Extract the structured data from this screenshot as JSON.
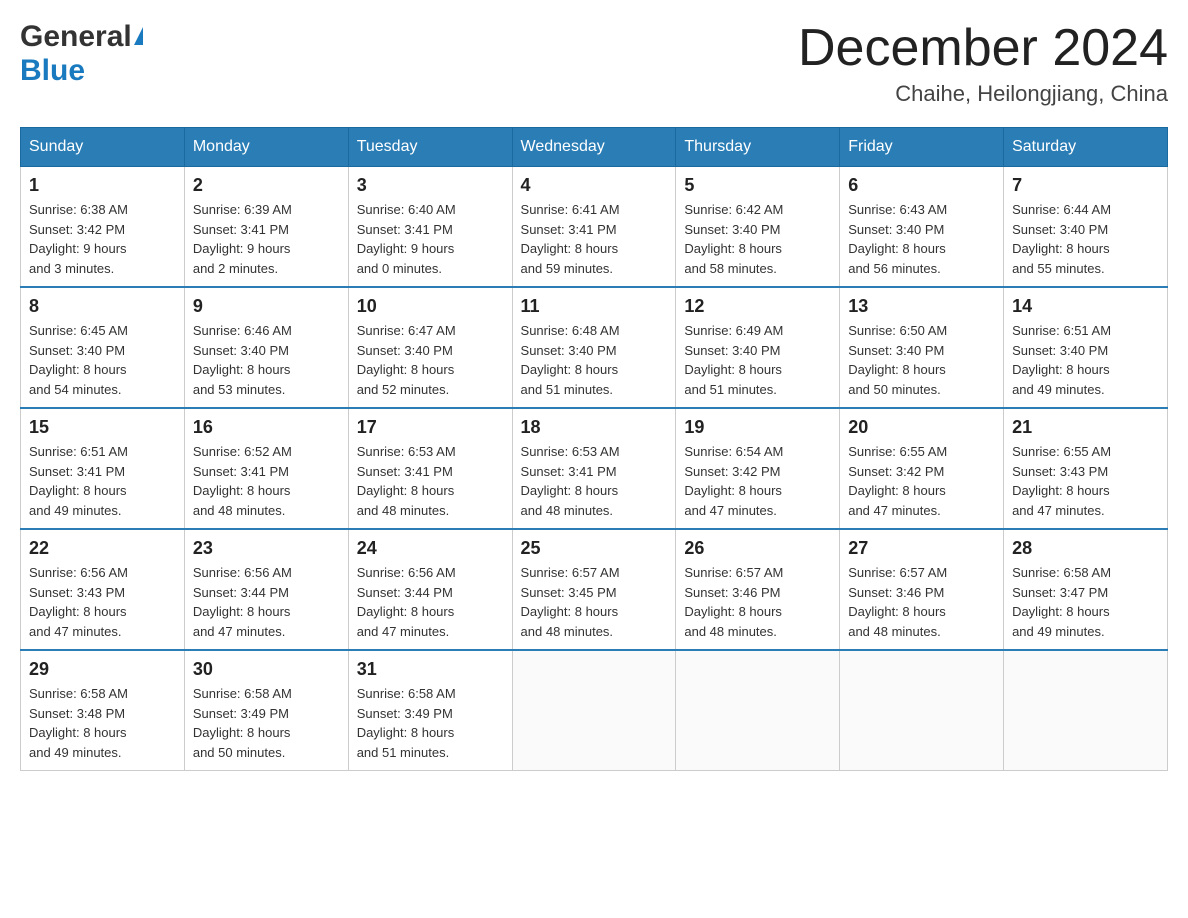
{
  "logo": {
    "general": "General",
    "blue": "Blue"
  },
  "title": {
    "month_year": "December 2024",
    "location": "Chaihe, Heilongjiang, China"
  },
  "headers": [
    "Sunday",
    "Monday",
    "Tuesday",
    "Wednesday",
    "Thursday",
    "Friday",
    "Saturday"
  ],
  "weeks": [
    [
      {
        "day": "1",
        "sunrise": "Sunrise: 6:38 AM",
        "sunset": "Sunset: 3:42 PM",
        "daylight": "Daylight: 9 hours",
        "daylight2": "and 3 minutes."
      },
      {
        "day": "2",
        "sunrise": "Sunrise: 6:39 AM",
        "sunset": "Sunset: 3:41 PM",
        "daylight": "Daylight: 9 hours",
        "daylight2": "and 2 minutes."
      },
      {
        "day": "3",
        "sunrise": "Sunrise: 6:40 AM",
        "sunset": "Sunset: 3:41 PM",
        "daylight": "Daylight: 9 hours",
        "daylight2": "and 0 minutes."
      },
      {
        "day": "4",
        "sunrise": "Sunrise: 6:41 AM",
        "sunset": "Sunset: 3:41 PM",
        "daylight": "Daylight: 8 hours",
        "daylight2": "and 59 minutes."
      },
      {
        "day": "5",
        "sunrise": "Sunrise: 6:42 AM",
        "sunset": "Sunset: 3:40 PM",
        "daylight": "Daylight: 8 hours",
        "daylight2": "and 58 minutes."
      },
      {
        "day": "6",
        "sunrise": "Sunrise: 6:43 AM",
        "sunset": "Sunset: 3:40 PM",
        "daylight": "Daylight: 8 hours",
        "daylight2": "and 56 minutes."
      },
      {
        "day": "7",
        "sunrise": "Sunrise: 6:44 AM",
        "sunset": "Sunset: 3:40 PM",
        "daylight": "Daylight: 8 hours",
        "daylight2": "and 55 minutes."
      }
    ],
    [
      {
        "day": "8",
        "sunrise": "Sunrise: 6:45 AM",
        "sunset": "Sunset: 3:40 PM",
        "daylight": "Daylight: 8 hours",
        "daylight2": "and 54 minutes."
      },
      {
        "day": "9",
        "sunrise": "Sunrise: 6:46 AM",
        "sunset": "Sunset: 3:40 PM",
        "daylight": "Daylight: 8 hours",
        "daylight2": "and 53 minutes."
      },
      {
        "day": "10",
        "sunrise": "Sunrise: 6:47 AM",
        "sunset": "Sunset: 3:40 PM",
        "daylight": "Daylight: 8 hours",
        "daylight2": "and 52 minutes."
      },
      {
        "day": "11",
        "sunrise": "Sunrise: 6:48 AM",
        "sunset": "Sunset: 3:40 PM",
        "daylight": "Daylight: 8 hours",
        "daylight2": "and 51 minutes."
      },
      {
        "day": "12",
        "sunrise": "Sunrise: 6:49 AM",
        "sunset": "Sunset: 3:40 PM",
        "daylight": "Daylight: 8 hours",
        "daylight2": "and 51 minutes."
      },
      {
        "day": "13",
        "sunrise": "Sunrise: 6:50 AM",
        "sunset": "Sunset: 3:40 PM",
        "daylight": "Daylight: 8 hours",
        "daylight2": "and 50 minutes."
      },
      {
        "day": "14",
        "sunrise": "Sunrise: 6:51 AM",
        "sunset": "Sunset: 3:40 PM",
        "daylight": "Daylight: 8 hours",
        "daylight2": "and 49 minutes."
      }
    ],
    [
      {
        "day": "15",
        "sunrise": "Sunrise: 6:51 AM",
        "sunset": "Sunset: 3:41 PM",
        "daylight": "Daylight: 8 hours",
        "daylight2": "and 49 minutes."
      },
      {
        "day": "16",
        "sunrise": "Sunrise: 6:52 AM",
        "sunset": "Sunset: 3:41 PM",
        "daylight": "Daylight: 8 hours",
        "daylight2": "and 48 minutes."
      },
      {
        "day": "17",
        "sunrise": "Sunrise: 6:53 AM",
        "sunset": "Sunset: 3:41 PM",
        "daylight": "Daylight: 8 hours",
        "daylight2": "and 48 minutes."
      },
      {
        "day": "18",
        "sunrise": "Sunrise: 6:53 AM",
        "sunset": "Sunset: 3:41 PM",
        "daylight": "Daylight: 8 hours",
        "daylight2": "and 48 minutes."
      },
      {
        "day": "19",
        "sunrise": "Sunrise: 6:54 AM",
        "sunset": "Sunset: 3:42 PM",
        "daylight": "Daylight: 8 hours",
        "daylight2": "and 47 minutes."
      },
      {
        "day": "20",
        "sunrise": "Sunrise: 6:55 AM",
        "sunset": "Sunset: 3:42 PM",
        "daylight": "Daylight: 8 hours",
        "daylight2": "and 47 minutes."
      },
      {
        "day": "21",
        "sunrise": "Sunrise: 6:55 AM",
        "sunset": "Sunset: 3:43 PM",
        "daylight": "Daylight: 8 hours",
        "daylight2": "and 47 minutes."
      }
    ],
    [
      {
        "day": "22",
        "sunrise": "Sunrise: 6:56 AM",
        "sunset": "Sunset: 3:43 PM",
        "daylight": "Daylight: 8 hours",
        "daylight2": "and 47 minutes."
      },
      {
        "day": "23",
        "sunrise": "Sunrise: 6:56 AM",
        "sunset": "Sunset: 3:44 PM",
        "daylight": "Daylight: 8 hours",
        "daylight2": "and 47 minutes."
      },
      {
        "day": "24",
        "sunrise": "Sunrise: 6:56 AM",
        "sunset": "Sunset: 3:44 PM",
        "daylight": "Daylight: 8 hours",
        "daylight2": "and 47 minutes."
      },
      {
        "day": "25",
        "sunrise": "Sunrise: 6:57 AM",
        "sunset": "Sunset: 3:45 PM",
        "daylight": "Daylight: 8 hours",
        "daylight2": "and 48 minutes."
      },
      {
        "day": "26",
        "sunrise": "Sunrise: 6:57 AM",
        "sunset": "Sunset: 3:46 PM",
        "daylight": "Daylight: 8 hours",
        "daylight2": "and 48 minutes."
      },
      {
        "day": "27",
        "sunrise": "Sunrise: 6:57 AM",
        "sunset": "Sunset: 3:46 PM",
        "daylight": "Daylight: 8 hours",
        "daylight2": "and 48 minutes."
      },
      {
        "day": "28",
        "sunrise": "Sunrise: 6:58 AM",
        "sunset": "Sunset: 3:47 PM",
        "daylight": "Daylight: 8 hours",
        "daylight2": "and 49 minutes."
      }
    ],
    [
      {
        "day": "29",
        "sunrise": "Sunrise: 6:58 AM",
        "sunset": "Sunset: 3:48 PM",
        "daylight": "Daylight: 8 hours",
        "daylight2": "and 49 minutes."
      },
      {
        "day": "30",
        "sunrise": "Sunrise: 6:58 AM",
        "sunset": "Sunset: 3:49 PM",
        "daylight": "Daylight: 8 hours",
        "daylight2": "and 50 minutes."
      },
      {
        "day": "31",
        "sunrise": "Sunrise: 6:58 AM",
        "sunset": "Sunset: 3:49 PM",
        "daylight": "Daylight: 8 hours",
        "daylight2": "and 51 minutes."
      },
      {
        "day": "",
        "sunrise": "",
        "sunset": "",
        "daylight": "",
        "daylight2": ""
      },
      {
        "day": "",
        "sunrise": "",
        "sunset": "",
        "daylight": "",
        "daylight2": ""
      },
      {
        "day": "",
        "sunrise": "",
        "sunset": "",
        "daylight": "",
        "daylight2": ""
      },
      {
        "day": "",
        "sunrise": "",
        "sunset": "",
        "daylight": "",
        "daylight2": ""
      }
    ]
  ]
}
